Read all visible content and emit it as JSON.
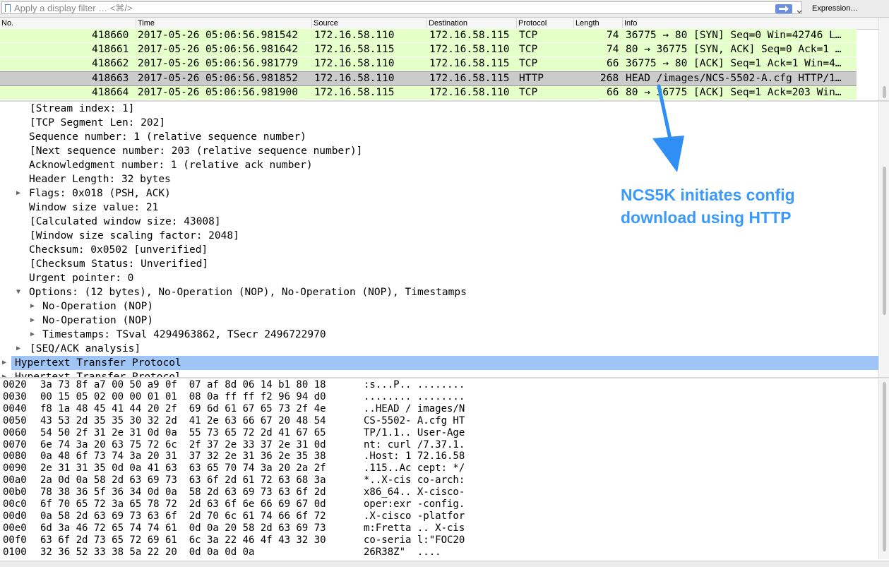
{
  "filter": {
    "placeholder": "Apply a display filter … <⌘/>",
    "expression_label": "Expression…"
  },
  "columns": [
    "No.",
    "Time",
    "Source",
    "Destination",
    "Protocol",
    "Length",
    "Info"
  ],
  "packets": [
    {
      "no": "418660",
      "time": "2017-05-26 05:06:56.981542",
      "src": "172.16.58.110",
      "dst": "172.16.58.115",
      "proto": "TCP",
      "len": "74",
      "info": "36775 → 80 [SYN] Seq=0 Win=42746 L…"
    },
    {
      "no": "418661",
      "time": "2017-05-26 05:06:56.981642",
      "src": "172.16.58.115",
      "dst": "172.16.58.110",
      "proto": "TCP",
      "len": "74",
      "info": "80 → 36775 [SYN, ACK] Seq=0 Ack=1 …"
    },
    {
      "no": "418662",
      "time": "2017-05-26 05:06:56.981779",
      "src": "172.16.58.110",
      "dst": "172.16.58.115",
      "proto": "TCP",
      "len": "66",
      "info": "36775 → 80 [ACK] Seq=1 Ack=1 Win=4…"
    },
    {
      "no": "418663",
      "time": "2017-05-26 05:06:56.981852",
      "src": "172.16.58.110",
      "dst": "172.16.58.115",
      "proto": "HTTP",
      "len": "268",
      "info": "HEAD /images/NCS-5502-A.cfg HTTP/1…"
    },
    {
      "no": "418664",
      "time": "2017-05-26 05:06:56.981900",
      "src": "172.16.58.115",
      "dst": "172.16.58.110",
      "proto": "TCP",
      "len": "66",
      "info": "80 → 36775 [ACK] Seq=1 Ack=203 Win…"
    }
  ],
  "details": [
    "[Stream index: 1]",
    "[TCP Segment Len: 202]",
    "Sequence number: 1    (relative sequence number)",
    "[Next sequence number: 203    (relative sequence number)]",
    "Acknowledgment number: 1    (relative ack number)",
    "Header Length: 32 bytes",
    "Flags: 0x018 (PSH, ACK)",
    "Window size value: 21",
    "[Calculated window size: 43008]",
    "[Window size scaling factor: 2048]",
    "Checksum: 0x0502 [unverified]",
    "[Checksum Status: Unverified]",
    "Urgent pointer: 0",
    "Options: (12 bytes), No-Operation (NOP), No-Operation (NOP), Timestamps",
    "No-Operation (NOP)",
    "No-Operation (NOP)",
    "Timestamps: TSval 4294963862, TSecr 2496722970",
    "[SEQ/ACK analysis]",
    "Hypertext Transfer Protocol",
    "Hypertext Transfer Protocol"
  ],
  "annotation": {
    "line1": "NCS5K initiates config",
    "line2": "download using HTTP"
  },
  "colors": {
    "tcp_row": "#e4ffc7",
    "selected_row": "#cbcbcb",
    "highlight_row": "#9ec5f5",
    "annotation": "#3b99f7"
  },
  "bytes": [
    {
      "off": "0020",
      "hex": "3a 73 8f a7 00 50 a9 0f  07 af 8d 06 14 b1 80 18",
      "ascii": ":s...P.. ........"
    },
    {
      "off": "0030",
      "hex": "00 15 05 02 00 00 01 01  08 0a ff ff f2 96 94 d0",
      "ascii": "........ ........"
    },
    {
      "off": "0040",
      "hex": "f8 1a 48 45 41 44 20 2f  69 6d 61 67 65 73 2f 4e",
      "ascii": "..HEAD / images/N"
    },
    {
      "off": "0050",
      "hex": "43 53 2d 35 35 30 32 2d  41 2e 63 66 67 20 48 54",
      "ascii": "CS-5502- A.cfg HT"
    },
    {
      "off": "0060",
      "hex": "54 50 2f 31 2e 31 0d 0a  55 73 65 72 2d 41 67 65",
      "ascii": "TP/1.1.. User-Age"
    },
    {
      "off": "0070",
      "hex": "6e 74 3a 20 63 75 72 6c  2f 37 2e 33 37 2e 31 0d",
      "ascii": "nt: curl /7.37.1."
    },
    {
      "off": "0080",
      "hex": "0a 48 6f 73 74 3a 20 31  37 32 2e 31 36 2e 35 38",
      "ascii": ".Host: 1 72.16.58"
    },
    {
      "off": "0090",
      "hex": "2e 31 31 35 0d 0a 41 63  63 65 70 74 3a 20 2a 2f",
      "ascii": ".115..Ac cept: */"
    },
    {
      "off": "00a0",
      "hex": "2a 0d 0a 58 2d 63 69 73  63 6f 2d 61 72 63 68 3a",
      "ascii": "*..X-cis co-arch:"
    },
    {
      "off": "00b0",
      "hex": "78 38 36 5f 36 34 0d 0a  58 2d 63 69 73 63 6f 2d",
      "ascii": "x86_64.. X-cisco-"
    },
    {
      "off": "00c0",
      "hex": "6f 70 65 72 3a 65 78 72  2d 63 6f 6e 66 69 67 0d",
      "ascii": "oper:exr -config."
    },
    {
      "off": "00d0",
      "hex": "0a 58 2d 63 69 73 63 6f  2d 70 6c 61 74 66 6f 72",
      "ascii": ".X-cisco -platfor"
    },
    {
      "off": "00e0",
      "hex": "6d 3a 46 72 65 74 74 61  0d 0a 20 58 2d 63 69 73",
      "ascii": "m:Fretta .. X-cis"
    },
    {
      "off": "00f0",
      "hex": "63 6f 2d 73 65 72 69 61  6c 3a 22 46 4f 43 32 30",
      "ascii": "co-seria l:\"FOC20"
    },
    {
      "off": "0100",
      "hex": "32 36 52 33 38 5a 22 20  0d 0a 0d 0a",
      "ascii": "26R38Z\"  ...."
    }
  ]
}
